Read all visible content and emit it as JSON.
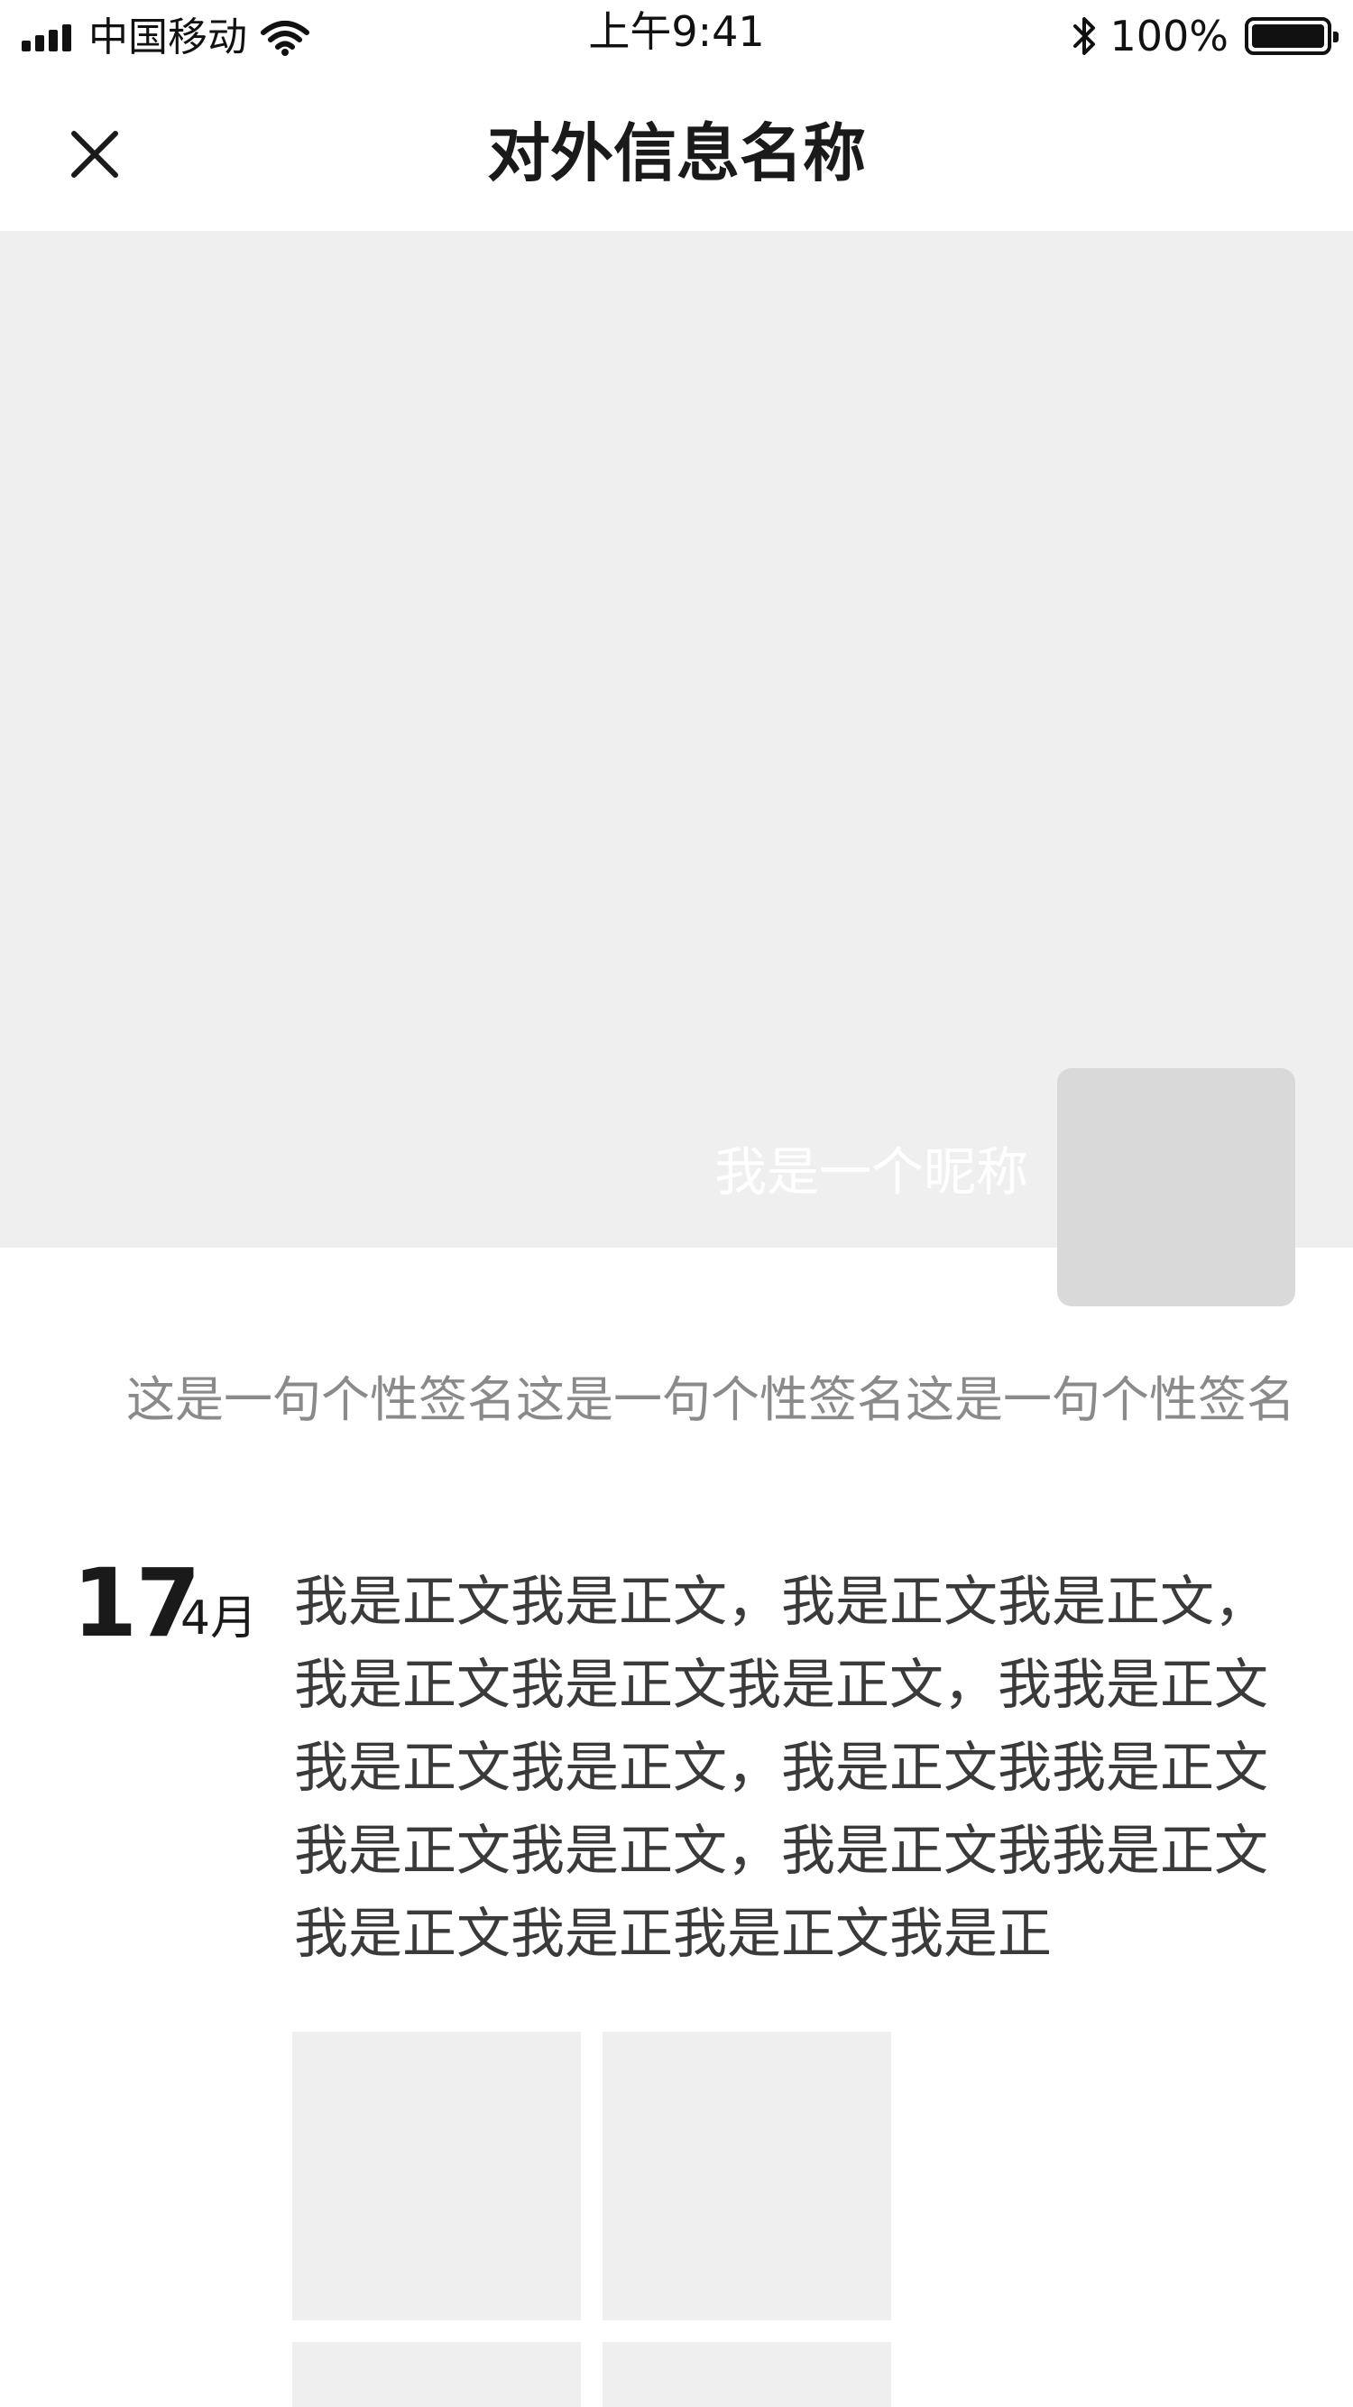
{
  "status_bar": {
    "carrier": "中国移动",
    "time": "上午9:41",
    "battery_percent": "100%",
    "icons": [
      "signal-icon",
      "wifi-icon",
      "bluetooth-icon",
      "battery-icon"
    ]
  },
  "nav": {
    "title": "对外信息名称",
    "close_icon": "close-icon"
  },
  "profile": {
    "nickname": "我是一个昵称",
    "signature": "这是一句个性签名这是一句个性签名这是一句个性签名"
  },
  "post": {
    "day": "17",
    "month": "4月",
    "body_lines": [
      "我是正文我是正文，我是正文我是正文，",
      "我是正文我是正文我是正文，我我是正文",
      "我是正文我是正文，我是正文我我是正文",
      "我是正文我是正文，我是正文我我是正文",
      "我是正文我是正我是正文我是正"
    ]
  },
  "colors": {
    "cover_bg": "#efefef",
    "avatar_bg": "#d9d9d9",
    "photo_bg": "#efefef",
    "signature_text": "#8a8a8a",
    "body_text": "#3a3a3a"
  }
}
